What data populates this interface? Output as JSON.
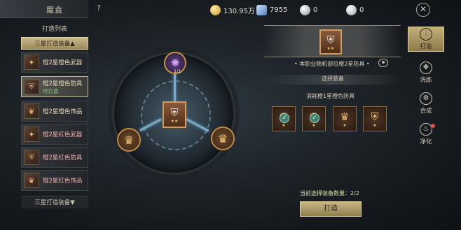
{
  "header": {
    "title": "魔盒",
    "help_icon": "question-icon",
    "resources": [
      {
        "icon": "gold-coin-icon",
        "value": "130.95万"
      },
      {
        "icon": "blue-crystal-icon",
        "value": "7955"
      },
      {
        "icon": "silver-gem-icon",
        "value": "0"
      },
      {
        "icon": "silver-orb-icon",
        "value": "0"
      }
    ],
    "close_icon": "close-icon"
  },
  "list": {
    "title": "打造列表",
    "tier_active": "三星打造装备",
    "tier_active_glyph": "▲",
    "tier_bottom": "三星打造装备",
    "tier_bottom_glyph": "▼",
    "items": [
      {
        "name": "橙2星橙色武器",
        "sub": "",
        "icon": "weapon-icon",
        "glyph": "✦",
        "red": false
      },
      {
        "name": "橙2星橙色防具",
        "sub": "可打造",
        "icon": "armor-icon",
        "glyph": "⛨",
        "red": false
      },
      {
        "name": "橙2星橙色饰品",
        "sub": "",
        "icon": "accessory-icon",
        "glyph": "❦",
        "red": false
      },
      {
        "name": "橙2星红色武器",
        "sub": "",
        "icon": "weapon-icon",
        "glyph": "✦",
        "red": true
      },
      {
        "name": "橙2星红色防具",
        "sub": "",
        "icon": "armor-icon",
        "glyph": "⛨",
        "red": true
      },
      {
        "name": "橙2星红色饰品",
        "sub": "",
        "icon": "accessory-icon",
        "glyph": "❦",
        "red": true
      }
    ]
  },
  "wheel": {
    "top_node_label": "1/1",
    "center_glyph": "⛨",
    "stars": "★★",
    "mat_glyph": "♛",
    "top_glyph": "✺"
  },
  "result": {
    "glyph": "⛨",
    "stars": "★★",
    "desc": "• 本职业随机部位橙2星防具 •",
    "select_head": "选择装备",
    "consume": "消耗橙1星橙色防具",
    "materials": [
      {
        "glyph": "♛",
        "checked": true
      },
      {
        "glyph": "♛",
        "checked": true
      },
      {
        "glyph": "♛",
        "checked": false
      },
      {
        "glyph": "⛨",
        "checked": false
      }
    ],
    "mat_stars": "★",
    "check_glyph": "✓",
    "count_label": "当前选择装备数量：2/2",
    "forge_button": "打造"
  },
  "nav": [
    {
      "label": "打造",
      "icon": "forge-icon",
      "glyph": "⫶",
      "active": true,
      "dot": false
    },
    {
      "label": "洗练",
      "icon": "refine-icon",
      "glyph": "✥",
      "active": false,
      "dot": false
    },
    {
      "label": "合成",
      "icon": "combine-icon",
      "glyph": "⚙",
      "active": false,
      "dot": false
    },
    {
      "label": "净化",
      "icon": "purify-icon",
      "glyph": "♨",
      "active": false,
      "dot": true
    }
  ],
  "colors": {
    "accent_gold": "#c8b783",
    "green_text": "#8fd06e",
    "star": "#f3c54d"
  }
}
